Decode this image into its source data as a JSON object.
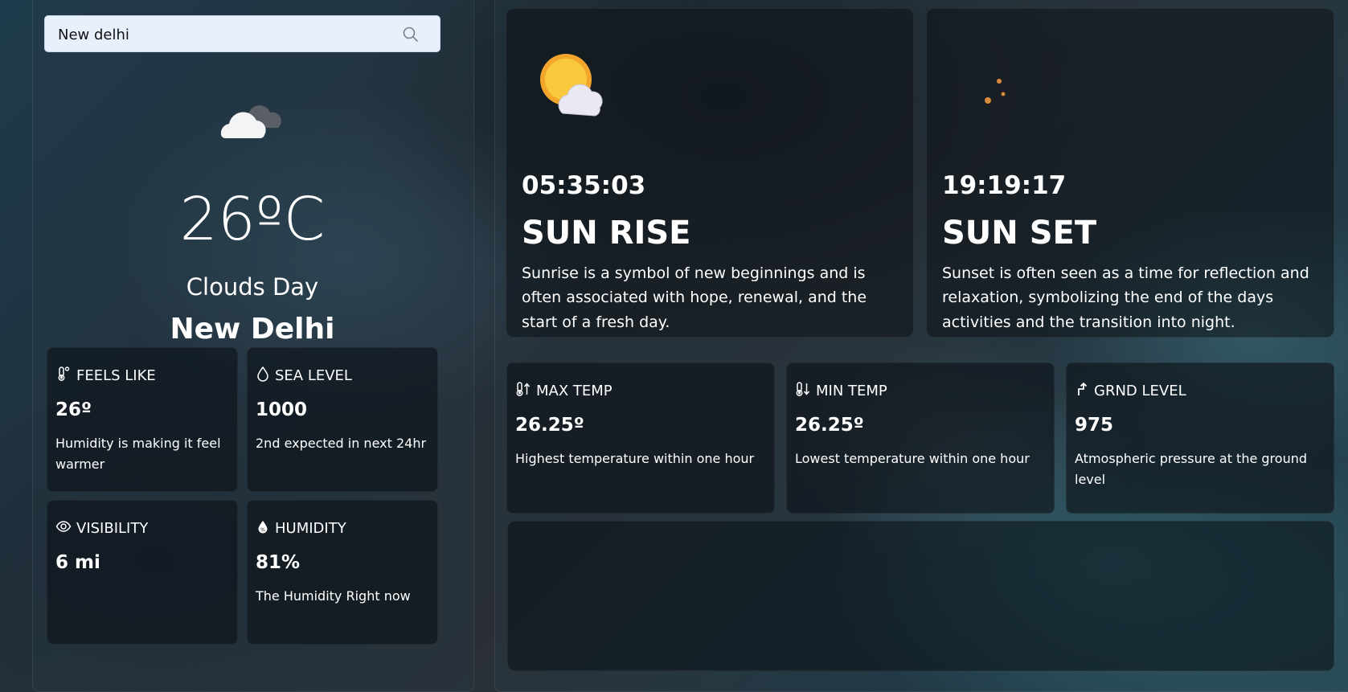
{
  "search": {
    "value": "New delhi",
    "icon": "search-icon"
  },
  "current": {
    "icon": "cloud-icon",
    "temperature": "26ºC",
    "condition": "Clouds Day",
    "city": "New Delhi"
  },
  "stats": [
    {
      "icon": "thermometer-feels-icon",
      "label": "FEELS LIKE",
      "value": "26º",
      "desc": "Humidity is making it feel warmer"
    },
    {
      "icon": "droplet-icon",
      "label": "SEA LEVEL",
      "value": "1000",
      "desc": "2nd expected in next 24hr"
    },
    {
      "icon": "eye-icon",
      "label": "VISIBILITY",
      "value": "6 mi",
      "desc": ""
    },
    {
      "icon": "humidity-icon",
      "label": "HUMIDITY",
      "value": "81%",
      "desc": "The Humidity Right now"
    }
  ],
  "sun": [
    {
      "icon": "sun-cloud-icon",
      "time": "05:35:03",
      "title": "SUN RISE",
      "desc": "Sunrise is a symbol of new beginnings and is often associated with hope, renewal, and the start of a fresh day."
    },
    {
      "icon": "moon-icon",
      "time": "19:19:17",
      "title": "SUN SET",
      "desc": "Sunset is often seen as a time for reflection and relaxation, symbolizing the end of the days activities and the transition into night."
    }
  ],
  "temps": [
    {
      "icon": "thermometer-up-icon",
      "label": "MAX TEMP",
      "value": "26.25º",
      "desc": "Highest temperature within one hour"
    },
    {
      "icon": "thermometer-down-icon",
      "label": "MIN TEMP",
      "value": "26.25º",
      "desc": "Lowest temperature within one hour"
    },
    {
      "icon": "arrow-up-right-icon",
      "label": "GRND LEVEL",
      "value": "975",
      "desc": "Atmospheric pressure at the ground level"
    }
  ]
}
